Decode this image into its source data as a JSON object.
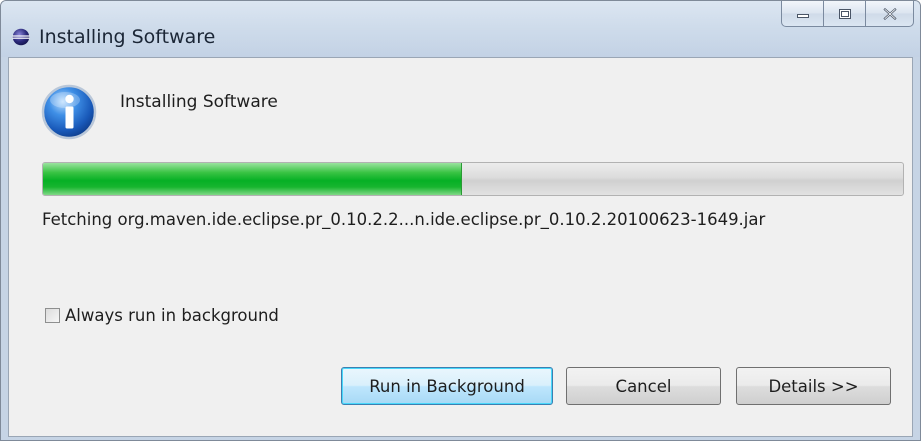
{
  "window": {
    "title": "Installing Software",
    "caption_buttons": [
      "minimize",
      "maximize",
      "close"
    ]
  },
  "dialog": {
    "icon": "info-icon",
    "message": "Installing Software",
    "progress_fraction": 0.486,
    "status": "Fetching org.maven.ide.eclipse.pr_0.10.2.2...n.ide.eclipse.pr_0.10.2.20100623-1649.jar",
    "always_background": {
      "label": "Always run in background",
      "checked": false
    },
    "buttons": {
      "run_in_background": "Run in Background",
      "cancel": "Cancel",
      "details": "Details >>"
    }
  },
  "colors": {
    "progress_green": "#06b025",
    "titlebar": "#c6d4e5",
    "client_bg": "#f0f0f0"
  }
}
